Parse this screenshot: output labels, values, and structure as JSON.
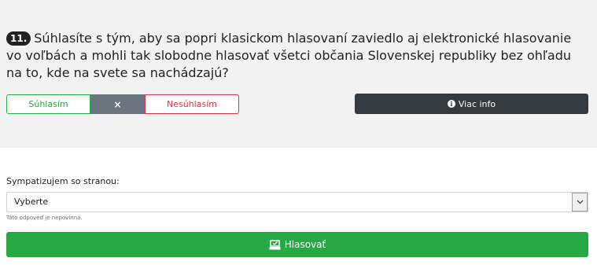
{
  "question": {
    "number": "11.",
    "text": "Súhlasíte s tým, aby sa popri klasickom hlasovaní zaviedlo aj elektronické hlasovanie vo voľbách a mohli tak slobodne hlasovať všetci občania Slovenskej republiky bez ohľadu na to, kde na svete sa nachádzajú?"
  },
  "answers": {
    "agree_label": "Súhlasím",
    "neutral_label": "×",
    "disagree_label": "Nesúhlasím"
  },
  "info_button": {
    "icon": "info-circle-icon",
    "label": "Viac info"
  },
  "party": {
    "label": "Sympatizujem so stranou:",
    "selected": "Vyberte",
    "note": "Táto odpoveď je nepovinná."
  },
  "vote_button": {
    "icon": "vote-box-icon",
    "label": "Hlasovať"
  },
  "colors": {
    "panel_bg": "#f2f2f2",
    "agree": "#28a745",
    "disagree": "#dc3545",
    "neutral": "#6c757d",
    "info_bg": "#343a40",
    "vote_bg": "#28a745"
  }
}
